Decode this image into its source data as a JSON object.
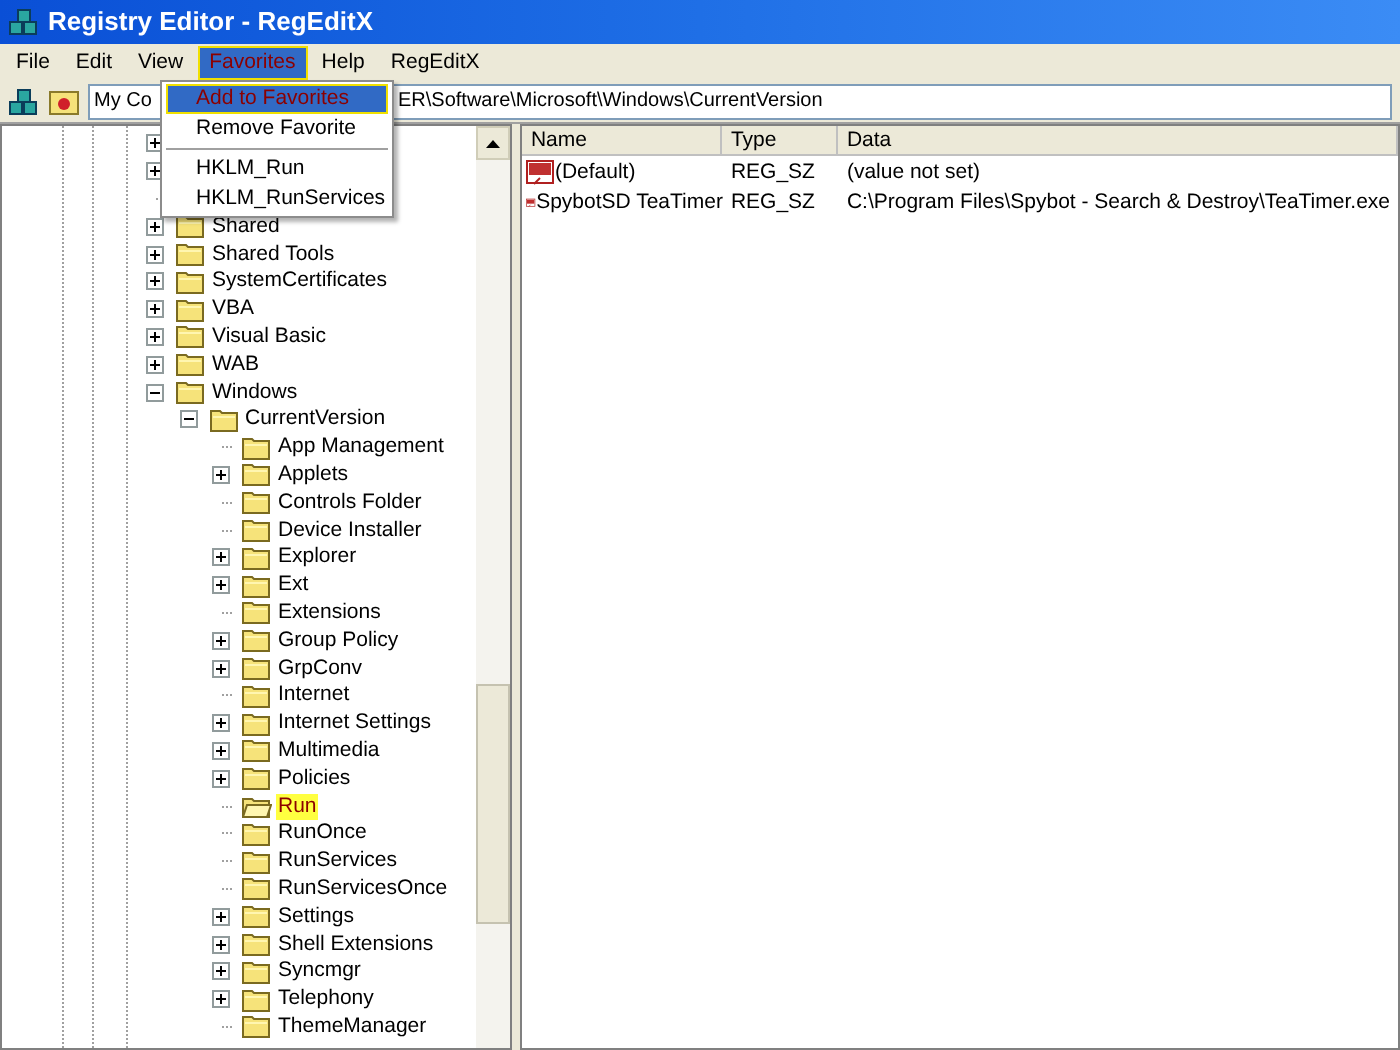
{
  "window": {
    "title": "Registry Editor - RegEditX"
  },
  "menu_bar": [
    {
      "label": "File",
      "selected": false
    },
    {
      "label": "Edit",
      "selected": false
    },
    {
      "label": "View",
      "selected": false
    },
    {
      "label": "Favorites",
      "selected": true
    },
    {
      "label": "Help",
      "selected": false
    },
    {
      "label": "RegEditX",
      "selected": false
    }
  ],
  "address": {
    "value_start": "My Co",
    "value_end": "ER\\Software\\Microsoft\\Windows\\CurrentVersion"
  },
  "favorites_menu": [
    {
      "kind": "item",
      "label": "Add to Favorites",
      "selected": true
    },
    {
      "kind": "item",
      "label": "Remove Favorite",
      "selected": false
    },
    {
      "kind": "separator"
    },
    {
      "kind": "item",
      "label": "HKLM_Run",
      "selected": false
    },
    {
      "kind": "item",
      "label": "HKLM_RunServices",
      "selected": false
    }
  ],
  "tree": [
    {
      "expandable": true,
      "expanded": false
    },
    {
      "expandable": true,
      "expanded": false
    },
    {
      "expandable": false
    },
    {
      "label": "Shared",
      "expandable": true,
      "expanded": false,
      "selected": false
    },
    {
      "label": "Shared Tools",
      "expandable": true,
      "expanded": false,
      "selected": false
    },
    {
      "label": "SystemCertificates",
      "expandable": true,
      "expanded": false,
      "selected": false
    },
    {
      "label": "VBA",
      "expandable": true,
      "expanded": false,
      "selected": false
    },
    {
      "label": "Visual Basic",
      "expandable": true,
      "expanded": false,
      "selected": false
    },
    {
      "label": "WAB",
      "expandable": true,
      "expanded": false,
      "selected": false
    },
    {
      "label": "Windows",
      "expandable": true,
      "expanded": true,
      "selected": false,
      "children": [
        {
          "label": "CurrentVersion",
          "expandable": true,
          "expanded": true,
          "selected": false,
          "children": [
            {
              "label": "App Management",
              "expandable": false,
              "selected": false
            },
            {
              "label": "Applets",
              "expandable": true,
              "expanded": false,
              "selected": false
            },
            {
              "label": "Controls Folder",
              "expandable": false,
              "selected": false
            },
            {
              "label": "Device Installer",
              "expandable": false,
              "selected": false
            },
            {
              "label": "Explorer",
              "expandable": true,
              "expanded": false,
              "selected": false
            },
            {
              "label": "Ext",
              "expandable": true,
              "expanded": false,
              "selected": false
            },
            {
              "label": "Extensions",
              "expandable": false,
              "selected": false
            },
            {
              "label": "Group Policy",
              "expandable": true,
              "expanded": false,
              "selected": false
            },
            {
              "label": "GrpConv",
              "expandable": true,
              "expanded": false,
              "selected": false
            },
            {
              "label": "Internet",
              "expandable": false,
              "selected": false
            },
            {
              "label": "Internet Settings",
              "expandable": true,
              "expanded": false,
              "selected": false
            },
            {
              "label": "Multimedia",
              "expandable": true,
              "expanded": false,
              "selected": false
            },
            {
              "label": "Policies",
              "expandable": true,
              "expanded": false,
              "selected": false
            },
            {
              "label": "Run",
              "expandable": false,
              "selected": true
            },
            {
              "label": "RunOnce",
              "expandable": false,
              "selected": false
            },
            {
              "label": "RunServices",
              "expandable": false,
              "selected": false
            },
            {
              "label": "RunServicesOnce",
              "expandable": false,
              "selected": false
            },
            {
              "label": "Settings",
              "expandable": true,
              "expanded": false,
              "selected": false
            },
            {
              "label": "Shell Extensions",
              "expandable": true,
              "expanded": false,
              "selected": false
            },
            {
              "label": "Syncmgr",
              "expandable": true,
              "expanded": false,
              "selected": false
            },
            {
              "label": "Telephony",
              "expandable": true,
              "expanded": false,
              "selected": false
            },
            {
              "label": "ThemeManager",
              "expandable": false,
              "selected": false
            }
          ]
        }
      ]
    }
  ],
  "values_table": {
    "columns": [
      "Name",
      "Type",
      "Data"
    ],
    "rows": [
      [
        "(Default)",
        "REG_SZ",
        "(value not set)"
      ],
      [
        "SpybotSD TeaTimer",
        "REG_SZ",
        "C:\\Program Files\\Spybot - Search & Destroy\\TeaTimer.exe"
      ]
    ]
  }
}
